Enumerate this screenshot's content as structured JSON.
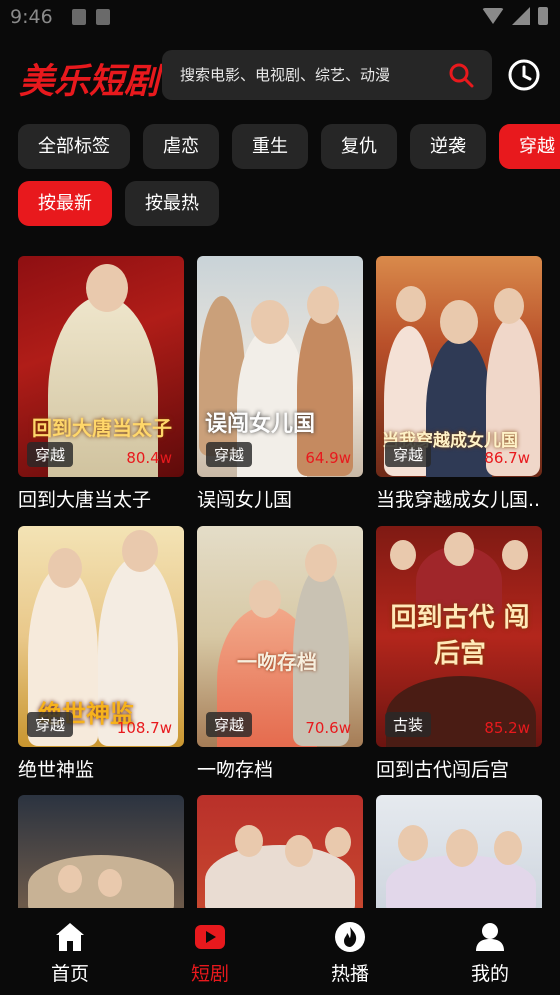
{
  "status": {
    "time": "9:46"
  },
  "header": {
    "logo": "美乐短剧",
    "search_placeholder": "搜索电影、电视剧、综艺、动漫"
  },
  "tags": [
    "全部标签",
    "虐恋",
    "重生",
    "复仇",
    "逆袭",
    "穿越"
  ],
  "active_tag": "穿越",
  "sorts": [
    "按最新",
    "按最热"
  ],
  "active_sort": "按最新",
  "cards": [
    {
      "title": "回到大唐当太子",
      "tag": "穿越",
      "views": "80.4w",
      "art": "回到大唐当太子"
    },
    {
      "title": "误闯女儿国",
      "tag": "穿越",
      "views": "64.9w",
      "art": "误闯女儿国"
    },
    {
      "title": "当我穿越成女儿国...",
      "tag": "穿越",
      "views": "86.7w",
      "art": "当我穿越成女儿国"
    },
    {
      "title": "绝世神监",
      "tag": "穿越",
      "views": "108.7w",
      "art": "绝世神监"
    },
    {
      "title": "一吻存档",
      "tag": "穿越",
      "views": "70.6w",
      "art": "一吻存档"
    },
    {
      "title": "回到古代闯后宫",
      "tag": "古装",
      "views": "85.2w",
      "art": "回到古代 闯后宫"
    },
    {
      "title": "",
      "tag": "",
      "views": "",
      "art": ""
    },
    {
      "title": "",
      "tag": "",
      "views": "",
      "art": ""
    },
    {
      "title": "",
      "tag": "",
      "views": "",
      "art": ""
    }
  ],
  "tabs": [
    {
      "label": "首页",
      "icon": "home-icon"
    },
    {
      "label": "短剧",
      "icon": "play-icon"
    },
    {
      "label": "热播",
      "icon": "flame-icon"
    },
    {
      "label": "我的",
      "icon": "user-icon"
    }
  ],
  "active_tab": "短剧",
  "colors": {
    "accent": "#e8191d",
    "background": "#0a0a0a",
    "chip": "#262626"
  }
}
